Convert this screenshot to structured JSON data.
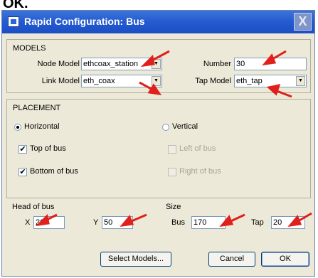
{
  "partial_top_text": "OK.",
  "dialog": {
    "title": "Rapid Configuration: Bus",
    "close_label": "X"
  },
  "models": {
    "section_title": "MODELS",
    "node_model_label": "Node Model",
    "node_model_value": "ethcoax_station",
    "number_label": "Number",
    "number_value": "30",
    "link_model_label": "Link Model",
    "link_model_value": "eth_coax",
    "tap_model_label": "Tap Model",
    "tap_model_value": "eth_tap"
  },
  "placement": {
    "section_title": "PLACEMENT",
    "horizontal_label": "Horizontal",
    "vertical_label": "Vertical",
    "top_of_bus_label": "Top of bus",
    "bottom_of_bus_label": "Bottom of bus",
    "left_of_bus_label": "Left of bus",
    "right_of_bus_label": "Right of bus",
    "orientation_selected": "horizontal",
    "top_of_bus_checked": true,
    "bottom_of_bus_checked": true
  },
  "head_of_bus": {
    "title": "Head of bus",
    "x_label": "X",
    "x_value": "20",
    "y_label": "Y",
    "y_value": "50"
  },
  "size": {
    "title": "Size",
    "bus_label": "Bus",
    "bus_value": "170",
    "tap_label": "Tap",
    "tap_value": "20"
  },
  "buttons": {
    "select_models": "Select Models...",
    "cancel": "Cancel",
    "ok": "OK"
  },
  "colors": {
    "titlebar": "#255ad0",
    "dialog_bg": "#ece9d8",
    "annotation_arrow": "#e0201a"
  }
}
